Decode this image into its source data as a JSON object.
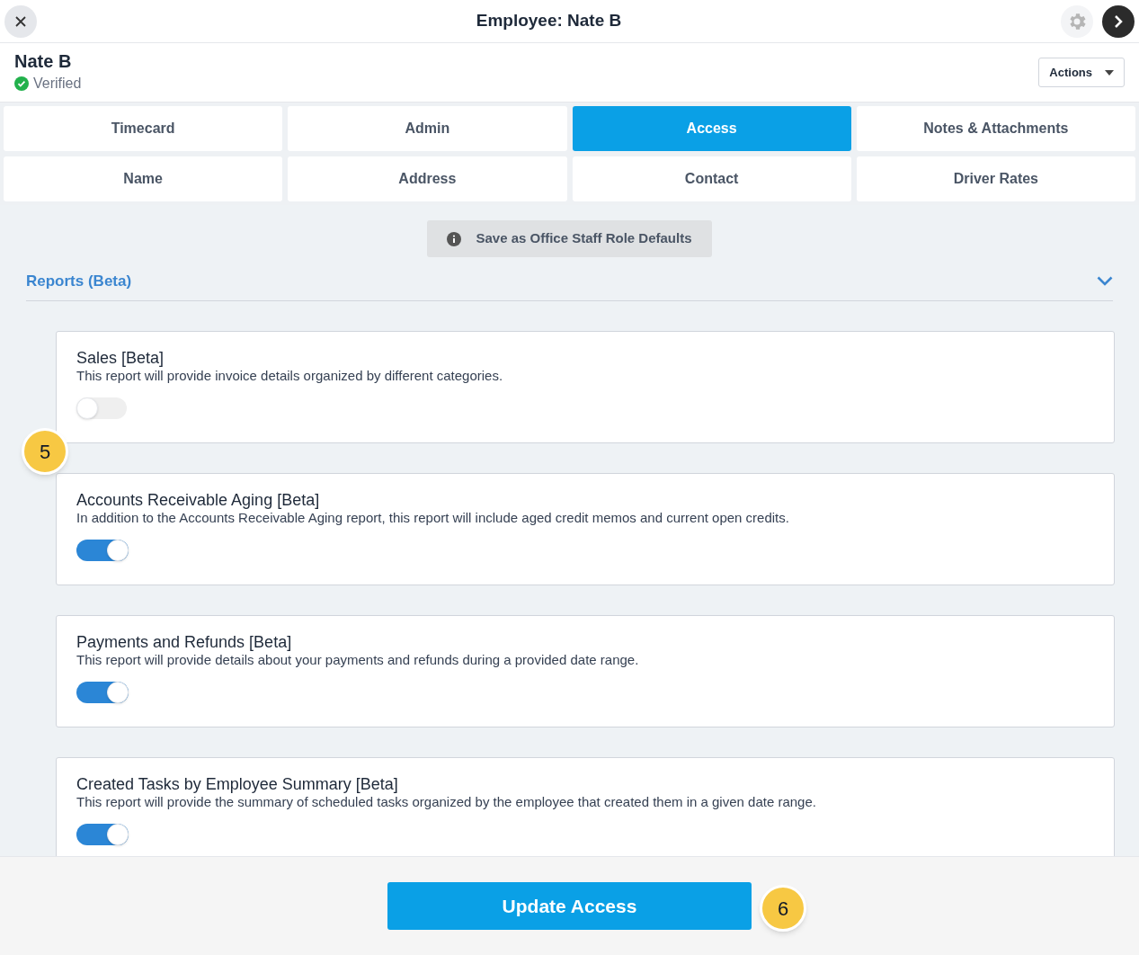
{
  "window": {
    "title": "Employee: Nate B"
  },
  "employee": {
    "name": "Nate B",
    "status": "Verified",
    "verified": true
  },
  "actions_button": "Actions",
  "tabs": [
    {
      "label": "Timecard",
      "selected": false
    },
    {
      "label": "Admin",
      "selected": false
    },
    {
      "label": "Access",
      "selected": true
    },
    {
      "label": "Notes & Attachments",
      "selected": false
    },
    {
      "label": "Name",
      "selected": false
    },
    {
      "label": "Address",
      "selected": false
    },
    {
      "label": "Contact",
      "selected": false
    },
    {
      "label": "Driver Rates",
      "selected": false
    }
  ],
  "defaults_button": "Save as Office Staff Role Defaults",
  "section": {
    "title": "Reports (Beta)",
    "expanded": true
  },
  "reports": [
    {
      "title": "Sales [Beta]",
      "description": "This report will provide invoice details organized by different categories.",
      "on": false
    },
    {
      "title": "Accounts Receivable Aging [Beta]",
      "description": "In addition to the Accounts Receivable Aging report, this report will include aged credit memos and current open credits.",
      "on": true
    },
    {
      "title": "Payments and Refunds [Beta]",
      "description": "This report will provide details about your payments and refunds during a provided date range.",
      "on": true
    },
    {
      "title": "Created Tasks by Employee Summary [Beta]",
      "description": "This report will provide the summary of scheduled tasks organized by the employee that created them in a given date range.",
      "on": true
    }
  ],
  "update_button": "Update Access",
  "step_markers": [
    "5",
    "6"
  ]
}
